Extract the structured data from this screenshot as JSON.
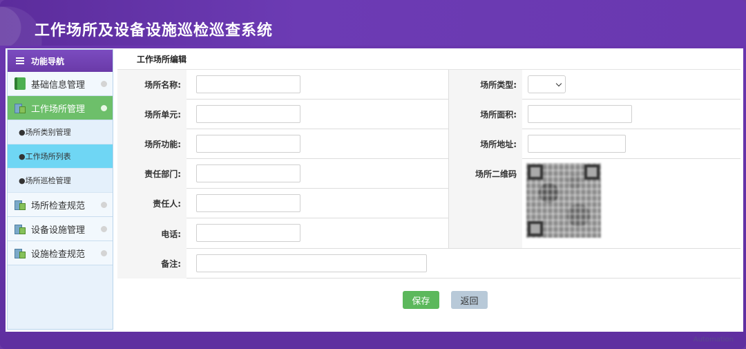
{
  "app": {
    "title": "工作场所及设备设施巡检巡查系统",
    "watermark": "Automation"
  },
  "sidebar": {
    "header": "功能导航",
    "items": [
      {
        "label": "基础信息管理",
        "icon": "book-icon",
        "active": false
      },
      {
        "label": "工作场所管理",
        "icon": "building-icon",
        "active": true
      },
      {
        "label": "场所检查规范",
        "icon": "building-icon",
        "active": false
      },
      {
        "label": "设备设施管理",
        "icon": "building-icon",
        "active": false
      },
      {
        "label": "设施检查规范",
        "icon": "building-icon",
        "active": false
      }
    ],
    "sub_items": [
      {
        "label": "●场所类别管理",
        "current": false
      },
      {
        "label": "●工作场所列表",
        "current": true
      },
      {
        "label": "●场所巡检管理",
        "current": false
      }
    ]
  },
  "main": {
    "tab_title": "工作场所编辑",
    "form": {
      "name_label": "场所名称:",
      "name_value": "",
      "type_label": "场所类型:",
      "type_value": "",
      "unit_label": "场所单元:",
      "unit_value": "",
      "area_label": "场所面积:",
      "area_value": "",
      "function_label": "场所功能:",
      "function_value": "",
      "address_label": "场所地址:",
      "address_value": "",
      "dept_label": "责任部门:",
      "dept_value": "",
      "qr_label": "场所二维码",
      "person_label": "责任人:",
      "person_value": "",
      "phone_label": "电话:",
      "phone_value": "",
      "remark_label": "备注:",
      "remark_value": ""
    },
    "buttons": {
      "save": "保存",
      "back": "返回"
    }
  },
  "colors": {
    "header": "#6a38b0",
    "active_nav": "#6dbf6a",
    "current_sub": "#6fd6f4",
    "save_button": "#5cb85c",
    "back_button": "#b8c9d8"
  }
}
